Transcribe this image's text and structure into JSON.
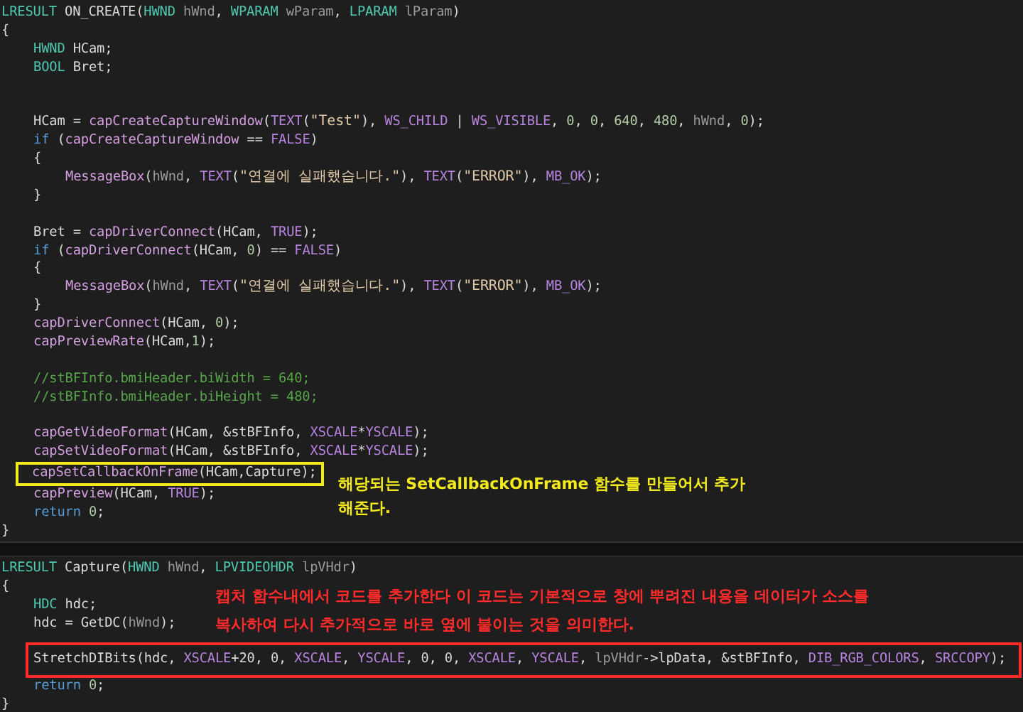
{
  "panels": [
    {
      "lines": [
        {
          "tokens": [
            {
              "kind": "type",
              "text": "LRESULT"
            },
            {
              "kind": "plain",
              "text": " ON_CREATE("
            },
            {
              "kind": "type",
              "text": "HWND"
            },
            {
              "kind": "param",
              "text": " hWnd"
            },
            {
              "kind": "plain",
              "text": ", "
            },
            {
              "kind": "type",
              "text": "WPARAM"
            },
            {
              "kind": "param",
              "text": " wParam"
            },
            {
              "kind": "plain",
              "text": ", "
            },
            {
              "kind": "type",
              "text": "LPARAM"
            },
            {
              "kind": "param",
              "text": " lParam"
            },
            {
              "kind": "plain",
              "text": ")"
            }
          ]
        },
        {
          "tokens": [
            {
              "kind": "plain",
              "text": "{"
            }
          ]
        },
        {
          "kind": "block",
          "children": [
            {
              "tokens": [
                {
                  "kind": "type",
                  "text": "HWND"
                },
                {
                  "kind": "plain",
                  "text": " HCam;"
                }
              ]
            },
            {
              "tokens": [
                {
                  "kind": "type",
                  "text": "BOOL"
                },
                {
                  "kind": "plain",
                  "text": " Bret;"
                }
              ]
            },
            {
              "kind": "blank"
            },
            {
              "kind": "blank"
            },
            {
              "tokens": [
                {
                  "kind": "plain",
                  "text": "HCam = "
                },
                {
                  "kind": "func",
                  "text": "capCreateCaptureWindow"
                },
                {
                  "kind": "plain",
                  "text": "("
                },
                {
                  "kind": "macro",
                  "text": "TEXT"
                },
                {
                  "kind": "plain",
                  "text": "("
                },
                {
                  "kind": "string",
                  "text": "\"Test\""
                },
                {
                  "kind": "plain",
                  "text": "), "
                },
                {
                  "kind": "macro",
                  "text": "WS_CHILD"
                },
                {
                  "kind": "plain",
                  "text": " | "
                },
                {
                  "kind": "macro",
                  "text": "WS_VISIBLE"
                },
                {
                  "kind": "plain",
                  "text": ", "
                },
                {
                  "kind": "number",
                  "text": "0"
                },
                {
                  "kind": "plain",
                  "text": ", "
                },
                {
                  "kind": "number",
                  "text": "0"
                },
                {
                  "kind": "plain",
                  "text": ", "
                },
                {
                  "kind": "number",
                  "text": "640"
                },
                {
                  "kind": "plain",
                  "text": ", "
                },
                {
                  "kind": "number",
                  "text": "480"
                },
                {
                  "kind": "plain",
                  "text": ", "
                },
                {
                  "kind": "param",
                  "text": "hWnd"
                },
                {
                  "kind": "plain",
                  "text": ", "
                },
                {
                  "kind": "number",
                  "text": "0"
                },
                {
                  "kind": "plain",
                  "text": ");"
                }
              ]
            },
            {
              "tokens": [
                {
                  "kind": "keyword",
                  "text": "if"
                },
                {
                  "kind": "plain",
                  "text": " ("
                },
                {
                  "kind": "func",
                  "text": "capCreateCaptureWindow"
                },
                {
                  "kind": "plain",
                  "text": " == "
                },
                {
                  "kind": "macro",
                  "text": "FALSE"
                },
                {
                  "kind": "plain",
                  "text": ")"
                }
              ]
            },
            {
              "tokens": [
                {
                  "kind": "plain",
                  "text": "{"
                }
              ]
            },
            {
              "kind": "block",
              "children": [
                {
                  "tokens": [
                    {
                      "kind": "func",
                      "text": "MessageBox"
                    },
                    {
                      "kind": "plain",
                      "text": "("
                    },
                    {
                      "kind": "param",
                      "text": "hWnd"
                    },
                    {
                      "kind": "plain",
                      "text": ", "
                    },
                    {
                      "kind": "macro",
                      "text": "TEXT"
                    },
                    {
                      "kind": "plain",
                      "text": "("
                    },
                    {
                      "kind": "string",
                      "text": "\"연결에 실패했습니다.\""
                    },
                    {
                      "kind": "plain",
                      "text": "), "
                    },
                    {
                      "kind": "macro",
                      "text": "TEXT"
                    },
                    {
                      "kind": "plain",
                      "text": "("
                    },
                    {
                      "kind": "string",
                      "text": "\"ERROR\""
                    },
                    {
                      "kind": "plain",
                      "text": "), "
                    },
                    {
                      "kind": "macro",
                      "text": "MB_OK"
                    },
                    {
                      "kind": "plain",
                      "text": ");"
                    }
                  ]
                }
              ]
            },
            {
              "tokens": [
                {
                  "kind": "plain",
                  "text": "}"
                }
              ]
            },
            {
              "kind": "blank"
            },
            {
              "tokens": [
                {
                  "kind": "plain",
                  "text": "Bret = "
                },
                {
                  "kind": "func",
                  "text": "capDriverConnect"
                },
                {
                  "kind": "plain",
                  "text": "(HCam, "
                },
                {
                  "kind": "macro",
                  "text": "TRUE"
                },
                {
                  "kind": "plain",
                  "text": ");"
                }
              ]
            },
            {
              "tokens": [
                {
                  "kind": "keyword",
                  "text": "if"
                },
                {
                  "kind": "plain",
                  "text": " ("
                },
                {
                  "kind": "func",
                  "text": "capDriverConnect"
                },
                {
                  "kind": "plain",
                  "text": "(HCam, "
                },
                {
                  "kind": "number",
                  "text": "0"
                },
                {
                  "kind": "plain",
                  "text": ") == "
                },
                {
                  "kind": "macro",
                  "text": "FALSE"
                },
                {
                  "kind": "plain",
                  "text": ")"
                }
              ]
            },
            {
              "tokens": [
                {
                  "kind": "plain",
                  "text": "{"
                }
              ]
            },
            {
              "kind": "block",
              "children": [
                {
                  "tokens": [
                    {
                      "kind": "func",
                      "text": "MessageBox"
                    },
                    {
                      "kind": "plain",
                      "text": "("
                    },
                    {
                      "kind": "param",
                      "text": "hWnd"
                    },
                    {
                      "kind": "plain",
                      "text": ", "
                    },
                    {
                      "kind": "macro",
                      "text": "TEXT"
                    },
                    {
                      "kind": "plain",
                      "text": "("
                    },
                    {
                      "kind": "string",
                      "text": "\"연결에 실패했습니다.\""
                    },
                    {
                      "kind": "plain",
                      "text": "), "
                    },
                    {
                      "kind": "macro",
                      "text": "TEXT"
                    },
                    {
                      "kind": "plain",
                      "text": "("
                    },
                    {
                      "kind": "string",
                      "text": "\"ERROR\""
                    },
                    {
                      "kind": "plain",
                      "text": "), "
                    },
                    {
                      "kind": "macro",
                      "text": "MB_OK"
                    },
                    {
                      "kind": "plain",
                      "text": ");"
                    }
                  ]
                }
              ]
            },
            {
              "tokens": [
                {
                  "kind": "plain",
                  "text": "}"
                }
              ]
            },
            {
              "tokens": [
                {
                  "kind": "func",
                  "text": "capDriverConnect"
                },
                {
                  "kind": "plain",
                  "text": "(HCam, "
                },
                {
                  "kind": "number",
                  "text": "0"
                },
                {
                  "kind": "plain",
                  "text": ");"
                }
              ]
            },
            {
              "tokens": [
                {
                  "kind": "func",
                  "text": "capPreviewRate"
                },
                {
                  "kind": "plain",
                  "text": "(HCam,"
                },
                {
                  "kind": "number",
                  "text": "1"
                },
                {
                  "kind": "plain",
                  "text": ");"
                }
              ]
            },
            {
              "kind": "blank"
            },
            {
              "tokens": [
                {
                  "kind": "comment",
                  "text": "//stBFInfo.bmiHeader.biWidth = 640;"
                }
              ]
            },
            {
              "tokens": [
                {
                  "kind": "comment",
                  "text": "//stBFInfo.bmiHeader.biHeight = 480;"
                }
              ]
            },
            {
              "kind": "blank"
            },
            {
              "tokens": [
                {
                  "kind": "func",
                  "text": "capGetVideoFormat"
                },
                {
                  "kind": "plain",
                  "text": "(HCam, &stBFInfo, "
                },
                {
                  "kind": "macro",
                  "text": "XSCALE"
                },
                {
                  "kind": "plain",
                  "text": "*"
                },
                {
                  "kind": "macro",
                  "text": "YSCALE"
                },
                {
                  "kind": "plain",
                  "text": ");"
                }
              ]
            },
            {
              "tokens": [
                {
                  "kind": "func",
                  "text": "capSetVideoFormat"
                },
                {
                  "kind": "plain",
                  "text": "(HCam, &stBFInfo, "
                },
                {
                  "kind": "macro",
                  "text": "XSCALE"
                },
                {
                  "kind": "plain",
                  "text": "*"
                },
                {
                  "kind": "macro",
                  "text": "YSCALE"
                },
                {
                  "kind": "plain",
                  "text": ");"
                }
              ]
            },
            {
              "tokens": [
                {
                  "kind": "func",
                  "text": "capSetCallbackOnFrame"
                },
                {
                  "kind": "plain",
                  "text": "(HCam,Capture);"
                }
              ],
              "callout": {
                "kind": "side",
                "color": "#f2ea1c",
                "lines": [
                  "해당되는 SetCallbackOnFrame 함수를 만들어서 추가",
                  "해준다."
                ]
              }
            },
            {
              "tokens": [
                {
                  "kind": "func",
                  "text": "capPreview"
                },
                {
                  "kind": "plain",
                  "text": "(HCam, "
                },
                {
                  "kind": "macro",
                  "text": "TRUE"
                },
                {
                  "kind": "plain",
                  "text": ");"
                }
              ]
            },
            {
              "tokens": [
                {
                  "kind": "keyword",
                  "text": "return "
                },
                {
                  "kind": "number",
                  "text": "0"
                },
                {
                  "kind": "plain",
                  "text": ";"
                }
              ]
            }
          ]
        },
        {
          "tokens": [
            {
              "kind": "plain",
              "text": "}"
            }
          ]
        }
      ]
    },
    {
      "lines": [
        {
          "tokens": [
            {
              "kind": "type",
              "text": "LRESULT"
            },
            {
              "kind": "plain",
              "text": " Capture("
            },
            {
              "kind": "type",
              "text": "HWND"
            },
            {
              "kind": "param",
              "text": " hWnd"
            },
            {
              "kind": "plain",
              "text": ", "
            },
            {
              "kind": "type",
              "text": "LPVIDEOHDR"
            },
            {
              "kind": "param",
              "text": " lpVHdr"
            },
            {
              "kind": "plain",
              "text": ")"
            }
          ]
        },
        {
          "tokens": [
            {
              "kind": "plain",
              "text": "{"
            }
          ]
        },
        {
          "kind": "block",
          "children": [
            {
              "tokens": [
                {
                  "kind": "type",
                  "text": "HDC"
                },
                {
                  "kind": "plain",
                  "text": " hdc;"
                }
              ]
            },
            {
              "tokens": [
                {
                  "kind": "plain",
                  "text": "hdc = GetDC("
                },
                {
                  "kind": "param",
                  "text": "hWnd"
                },
                {
                  "kind": "plain",
                  "text": ");"
                }
              ]
            },
            {
              "kind": "blank"
            },
            {
              "tokens": [
                {
                  "kind": "plain",
                  "text": "StretchDIBits(hdc, "
                },
                {
                  "kind": "macro",
                  "text": "XSCALE"
                },
                {
                  "kind": "plain",
                  "text": "+20, 0, "
                },
                {
                  "kind": "macro",
                  "text": "XSCALE"
                },
                {
                  "kind": "plain",
                  "text": ", "
                },
                {
                  "kind": "macro",
                  "text": "YSCALE"
                },
                {
                  "kind": "plain",
                  "text": ", 0, 0, "
                },
                {
                  "kind": "macro",
                  "text": "XSCALE"
                },
                {
                  "kind": "plain",
                  "text": ", "
                },
                {
                  "kind": "macro",
                  "text": "YSCALE"
                },
                {
                  "kind": "plain",
                  "text": ", "
                },
                {
                  "kind": "param",
                  "text": "lpVHdr"
                },
                {
                  "kind": "plain",
                  "text": "->lpData, &stBFInfo, "
                },
                {
                  "kind": "macro",
                  "text": "DIB_RGB_COLORS"
                },
                {
                  "kind": "plain",
                  "text": ", "
                },
                {
                  "kind": "macro",
                  "text": "SRCCOPY"
                },
                {
                  "kind": "plain",
                  "text": ");"
                }
              ],
              "callout": {
                "kind": "above",
                "color": "#ff2a2a",
                "lines": [
                  "캡처 함수내에서 코드를 추가한다 이 코드는 기본적으로 창에 뿌려진 내용을 데이터가 소스를",
                  "복사하여 다시 추가적으로 바로 옆에 붙이는 것을 의미한다."
                ]
              }
            },
            {
              "tokens": [
                {
                  "kind": "keyword",
                  "text": "return "
                },
                {
                  "kind": "number",
                  "text": "0"
                },
                {
                  "kind": "plain",
                  "text": ";"
                }
              ]
            }
          ]
        },
        {
          "tokens": [
            {
              "kind": "plain",
              "text": "}"
            }
          ]
        }
      ]
    }
  ]
}
